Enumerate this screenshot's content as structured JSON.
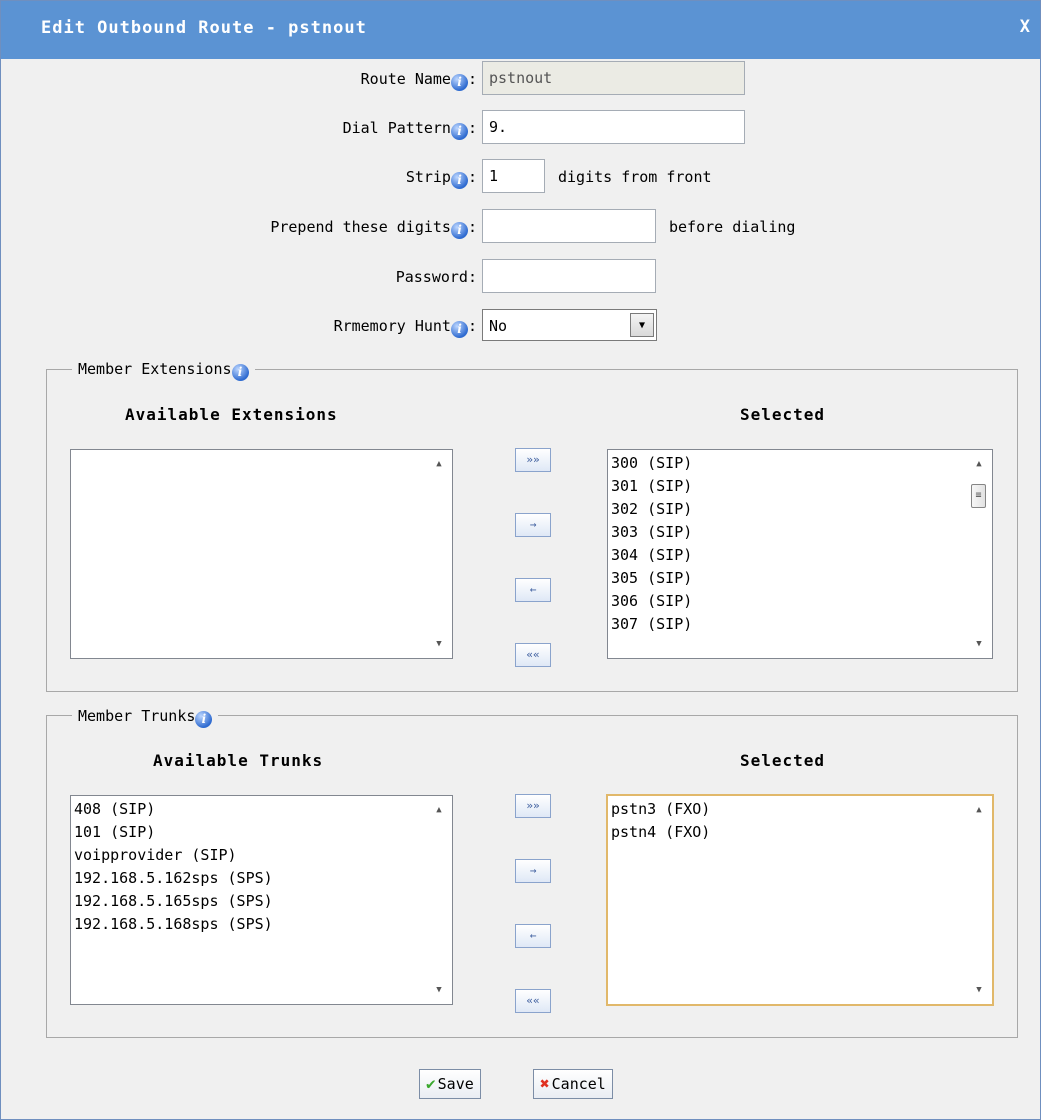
{
  "dialog": {
    "title": "Edit Outbound Route - pstnout",
    "close": "X"
  },
  "form": {
    "route_name": {
      "label": "Route Name",
      "value": "pstnout"
    },
    "dial_pattern": {
      "label": "Dial Pattern",
      "value": "9."
    },
    "strip": {
      "label": "Strip",
      "value": "1",
      "suffix": "digits from front"
    },
    "prepend": {
      "label": "Prepend these digits",
      "value": "",
      "suffix": "before dialing"
    },
    "password": {
      "label": "Password:",
      "value": ""
    },
    "rrmemory": {
      "label": "Rrmemory Hunt",
      "value": "No"
    },
    "colon": ":"
  },
  "info_icon": "i",
  "extensions": {
    "legend": "Member Extensions",
    "available_header": "Available Extensions",
    "selected_header": "Selected",
    "available": [],
    "selected": [
      "300 (SIP)",
      "301 (SIP)",
      "302 (SIP)",
      "303 (SIP)",
      "304 (SIP)",
      "305 (SIP)",
      "306 (SIP)",
      "307 (SIP)"
    ]
  },
  "trunks": {
    "legend": "Member Trunks",
    "available_header": "Available Trunks",
    "selected_header": "Selected",
    "available": [
      "408 (SIP)",
      "101 (SIP)",
      "voipprovider (SIP)",
      "192.168.5.162sps (SPS)",
      "192.168.5.165sps (SPS)",
      "192.168.5.168sps (SPS)"
    ],
    "selected": [
      "pstn3 (FXO)",
      "pstn4 (FXO)"
    ]
  },
  "move_buttons": {
    "add_all": "»»",
    "add": "→",
    "remove": "←",
    "remove_all": "««"
  },
  "buttons": {
    "save": "Save",
    "cancel": "Cancel"
  },
  "icons": {
    "save": "check-icon",
    "cancel": "cross-icon"
  },
  "colors": {
    "titlebar": "#5b93d3",
    "focus_border": "#e1b86a"
  }
}
